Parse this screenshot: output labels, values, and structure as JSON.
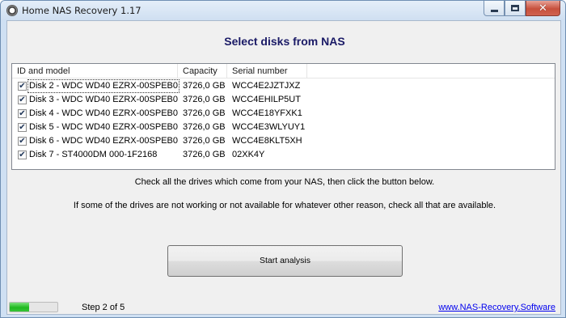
{
  "window": {
    "title": "Home NAS Recovery 1.17"
  },
  "main": {
    "heading": "Select disks from NAS",
    "columns": [
      "ID and model",
      "Capacity",
      "Serial number"
    ],
    "disks": [
      {
        "checked": true,
        "id_model": "Disk 2 - WDC WD40 EZRX-00SPEB0",
        "capacity": "3726,0 GB",
        "serial": "WCC4E2JZTJXZ"
      },
      {
        "checked": true,
        "id_model": "Disk 3 - WDC WD40 EZRX-00SPEB0",
        "capacity": "3726,0 GB",
        "serial": "WCC4EHILP5UT"
      },
      {
        "checked": true,
        "id_model": "Disk 4 - WDC WD40 EZRX-00SPEB0",
        "capacity": "3726,0 GB",
        "serial": "WCC4E18YFXK1"
      },
      {
        "checked": true,
        "id_model": "Disk 5 - WDC WD40 EZRX-00SPEB0",
        "capacity": "3726,0 GB",
        "serial": "WCC4E3WLYUY1"
      },
      {
        "checked": true,
        "id_model": "Disk 6 - WDC WD40 EZRX-00SPEB0",
        "capacity": "3726,0 GB",
        "serial": "WCC4E8KLT5XH"
      },
      {
        "checked": true,
        "id_model": "Disk 7 - ST4000DM 000-1F2168",
        "capacity": "3726,0 GB",
        "serial": "02XK4Y"
      }
    ],
    "instruction_1": "Check all the drives which come from your NAS, then click the button below.",
    "instruction_2": "If some of the drives are not working or not available for whatever other reason, check all that are available.",
    "start_button": "Start analysis"
  },
  "status": {
    "progress": 0.4,
    "step_text": "Step 2 of 5",
    "website": "www.NAS-Recovery.Software"
  },
  "icons": {
    "check": "✔"
  }
}
